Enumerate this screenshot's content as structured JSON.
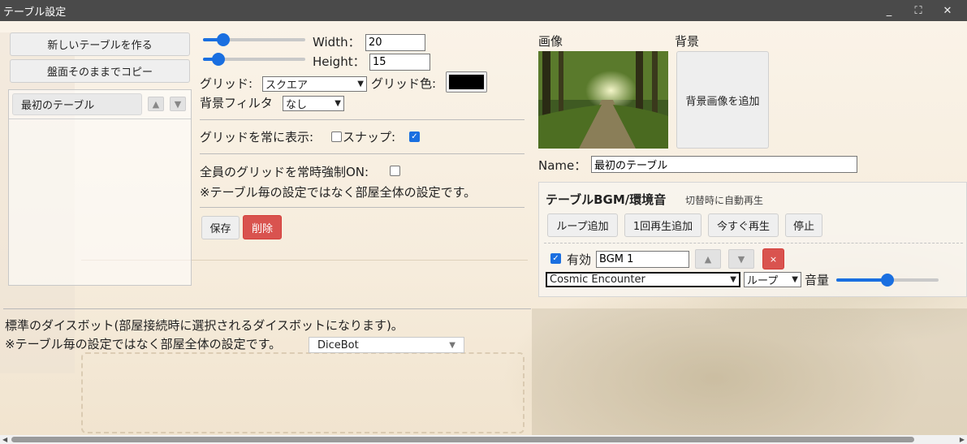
{
  "window": {
    "title": "テーブル設定",
    "minimize": "_",
    "maximize": "⛶",
    "close": "✕"
  },
  "left": {
    "new_table_button": "新しいテーブルを作る",
    "copy_button": "盤面そのままでコピー",
    "tables": [
      {
        "label": "最初のテーブル"
      }
    ],
    "up": "▲",
    "down": "▼"
  },
  "grid_settings": {
    "width_label": "Width：",
    "width_value": "20",
    "width_fraction": 0.2,
    "height_label": "Height：",
    "height_value": "15",
    "height_fraction": 0.15,
    "grid_label": "グリッド:",
    "grid_type": "スクエア",
    "grid_color_label": "グリッド色:",
    "grid_color": "#000000",
    "filter_label": "背景フィルタ",
    "filter_value": "なし",
    "always_show_label": "グリッドを常に表示:",
    "always_show_checked": false,
    "snap_label": "スナップ:",
    "snap_checked": true,
    "force_label": "全員のグリッドを常時強制ON:",
    "force_checked": false,
    "force_note": "※テーブル毎の設定ではなく部屋全体の設定です。",
    "save_button": "保存",
    "delete_button": "削除"
  },
  "image_section": {
    "image_label": "画像",
    "background_label": "背景",
    "add_background_button": "背景画像を追加",
    "name_label": "Name：",
    "name_value": "最初のテーブル"
  },
  "bgm": {
    "title": "テーブルBGM/環境音",
    "subtitle": "切替時に自動再生",
    "add_loop_button": "ループ追加",
    "add_once_button": "1回再生追加",
    "play_now_button": "今すぐ再生",
    "stop_button": "停止",
    "enabled_label": "有効",
    "enabled_checked": true,
    "track_name": "BGM 1",
    "up": "▲",
    "down": "▼",
    "remove": "×",
    "track_select": "Cosmic Encounter",
    "mode_select": "ループ",
    "volume_label": "音量",
    "volume_fraction": 0.5
  },
  "dicebot": {
    "line1": "標準のダイスボット(部屋接続時に選択されるダイスボットになります)。",
    "line2": "※テーブル毎の設定ではなく部屋全体の設定です。",
    "value": "DiceBot"
  },
  "colors": {
    "accent": "#1a6fe0",
    "danger": "#d9534f",
    "titlebar": "#4a4a4a"
  }
}
